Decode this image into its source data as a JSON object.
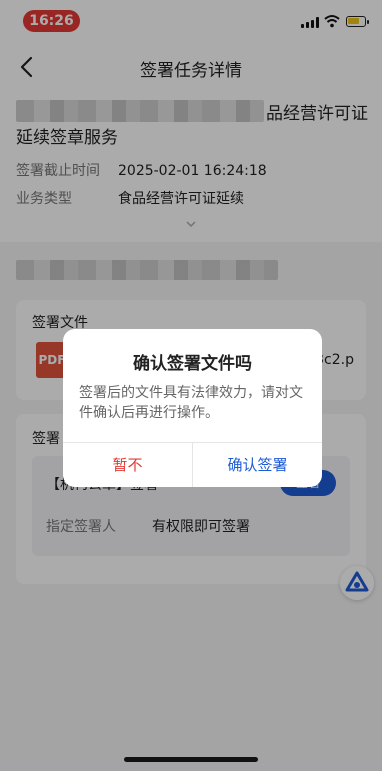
{
  "status_bar": {
    "time": "16:26"
  },
  "nav": {
    "title": "签署任务详情"
  },
  "task": {
    "title_visible_end": "品经营许可证",
    "title_line2": "延续签章服务",
    "deadline_label": "签署截止时间",
    "deadline_value": "2025-02-01 16:24:18",
    "type_label": "业务类型",
    "type_value": "食品经营许可证延续"
  },
  "files_section": {
    "title": "签署文件",
    "file_icon_label": "PDF",
    "file_name_visible": "3c2.p"
  },
  "signers_section": {
    "title": "签署",
    "signer_label": "【机构公章】签署",
    "sign_button": "签署",
    "designated_label": "指定签署人",
    "designated_value": "有权限即可签署"
  },
  "dialog": {
    "title": "确认签署文件吗",
    "message": "签署后的文件具有法律效力，请对文件确认后再进行操作。",
    "cancel_label": "暂不",
    "confirm_label": "确认签署"
  }
}
